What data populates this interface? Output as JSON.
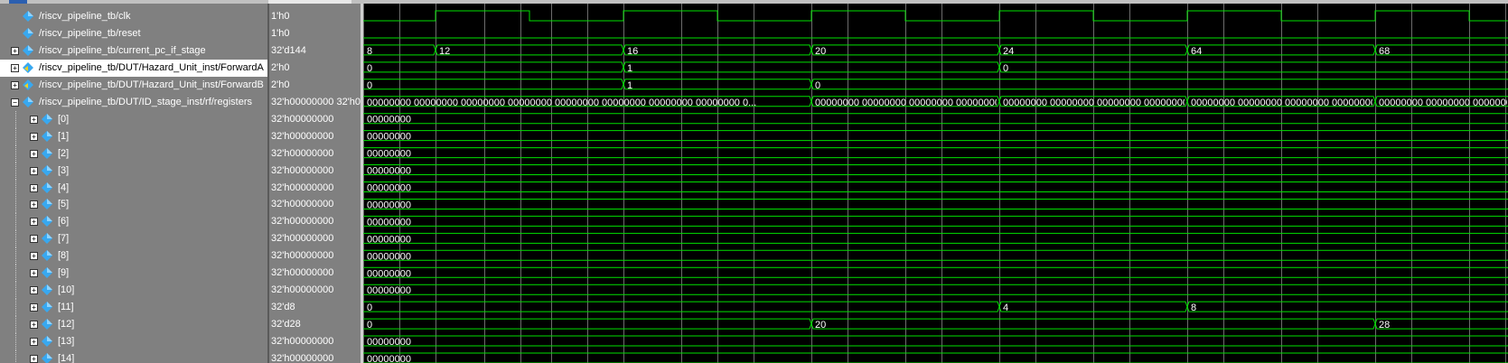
{
  "signals": [
    {
      "name": "/riscv_pipeline_tb/clk",
      "value": "1'h0",
      "expandable": false,
      "expanded": false,
      "icon": "signal-diamond-icon",
      "indent": 0,
      "selected": false
    },
    {
      "name": "/riscv_pipeline_tb/reset",
      "value": "1'h0",
      "expandable": false,
      "expanded": false,
      "icon": "signal-diamond-icon",
      "indent": 0,
      "selected": false
    },
    {
      "name": "/riscv_pipeline_tb/current_pc_if_stage",
      "value": "32'd144",
      "expandable": true,
      "expanded": false,
      "icon": "signal-diamond-icon",
      "indent": 0,
      "selected": false
    },
    {
      "name": "/riscv_pipeline_tb/DUT/Hazard_Unit_inst/ForwardA",
      "value": "2'h0",
      "expandable": true,
      "expanded": false,
      "icon": "output-port-icon",
      "indent": 0,
      "selected": true
    },
    {
      "name": "/riscv_pipeline_tb/DUT/Hazard_Unit_inst/ForwardB",
      "value": "2'h0",
      "expandable": true,
      "expanded": false,
      "icon": "output-port-icon",
      "indent": 0,
      "selected": false
    },
    {
      "name": "/riscv_pipeline_tb/DUT/ID_stage_inst/rf/registers",
      "value": "32'h00000000 32'h0...",
      "expandable": true,
      "expanded": true,
      "icon": "signal-diamond-icon",
      "indent": 0,
      "selected": false
    },
    {
      "name": "[0]",
      "value": "32'h00000000",
      "expandable": true,
      "expanded": false,
      "icon": "signal-diamond-icon",
      "indent": 1,
      "selected": false
    },
    {
      "name": "[1]",
      "value": "32'h00000000",
      "expandable": true,
      "expanded": false,
      "icon": "signal-diamond-icon",
      "indent": 1,
      "selected": false
    },
    {
      "name": "[2]",
      "value": "32'h00000000",
      "expandable": true,
      "expanded": false,
      "icon": "signal-diamond-icon",
      "indent": 1,
      "selected": false
    },
    {
      "name": "[3]",
      "value": "32'h00000000",
      "expandable": true,
      "expanded": false,
      "icon": "signal-diamond-icon",
      "indent": 1,
      "selected": false
    },
    {
      "name": "[4]",
      "value": "32'h00000000",
      "expandable": true,
      "expanded": false,
      "icon": "signal-diamond-icon",
      "indent": 1,
      "selected": false
    },
    {
      "name": "[5]",
      "value": "32'h00000000",
      "expandable": true,
      "expanded": false,
      "icon": "signal-diamond-icon",
      "indent": 1,
      "selected": false
    },
    {
      "name": "[6]",
      "value": "32'h00000000",
      "expandable": true,
      "expanded": false,
      "icon": "signal-diamond-icon",
      "indent": 1,
      "selected": false
    },
    {
      "name": "[7]",
      "value": "32'h00000000",
      "expandable": true,
      "expanded": false,
      "icon": "signal-diamond-icon",
      "indent": 1,
      "selected": false
    },
    {
      "name": "[8]",
      "value": "32'h00000000",
      "expandable": true,
      "expanded": false,
      "icon": "signal-diamond-icon",
      "indent": 1,
      "selected": false
    },
    {
      "name": "[9]",
      "value": "32'h00000000",
      "expandable": true,
      "expanded": false,
      "icon": "signal-diamond-icon",
      "indent": 1,
      "selected": false
    },
    {
      "name": "[10]",
      "value": "32'h00000000",
      "expandable": true,
      "expanded": false,
      "icon": "signal-diamond-icon",
      "indent": 1,
      "selected": false
    },
    {
      "name": "[11]",
      "value": "32'd8",
      "expandable": true,
      "expanded": false,
      "icon": "signal-diamond-icon",
      "indent": 1,
      "selected": false
    },
    {
      "name": "[12]",
      "value": "32'd28",
      "expandable": true,
      "expanded": false,
      "icon": "signal-diamond-icon",
      "indent": 1,
      "selected": false
    },
    {
      "name": "[13]",
      "value": "32'h00000000",
      "expandable": true,
      "expanded": false,
      "icon": "signal-diamond-icon",
      "indent": 1,
      "selected": false
    },
    {
      "name": "[14]",
      "value": "32'h00000000",
      "expandable": true,
      "expanded": false,
      "icon": "signal-diamond-icon",
      "indent": 1,
      "selected": false
    }
  ],
  "waveforms": [
    {
      "kind": "clock",
      "initial": 0,
      "edges": [
        80,
        184,
        288,
        392,
        496,
        600,
        704,
        808,
        912,
        1016,
        1120,
        1224
      ]
    },
    {
      "kind": "bit_const",
      "level": 0
    },
    {
      "kind": "bus",
      "segments": [
        {
          "text": "8"
        },
        {
          "text": "12"
        },
        {
          "text": "16"
        },
        {
          "text": "20"
        },
        {
          "text": "24"
        },
        {
          "text": "64"
        },
        {
          "text": "68"
        }
      ]
    },
    {
      "kind": "bus",
      "segments": [
        {
          "text": "0"
        },
        {
          "text": "1"
        },
        {
          "text": "0"
        }
      ]
    },
    {
      "kind": "bus",
      "segments": [
        {
          "text": "0"
        },
        {
          "text": "1"
        },
        {
          "text": "0"
        }
      ]
    },
    {
      "kind": "bus",
      "segments": [
        {
          "text": "00000000 00000000 00000000 00000000 00000000 00000000 00000000 00000000 0..."
        },
        {
          "text": "00000000 00000000 00000000 00000000 000..."
        },
        {
          "text": "00000000 00000000 00000000 00000000 000..."
        },
        {
          "text": "00000000 00000000 00000000 00000000 000..."
        },
        {
          "text": "00000000 00000000 00000000 00000000 000..."
        }
      ]
    },
    {
      "kind": "bus",
      "segments": [
        {
          "text": "00000000"
        }
      ]
    },
    {
      "kind": "bus",
      "segments": [
        {
          "text": "00000000"
        }
      ]
    },
    {
      "kind": "bus",
      "segments": [
        {
          "text": "00000000"
        }
      ]
    },
    {
      "kind": "bus",
      "segments": [
        {
          "text": "00000000"
        }
      ]
    },
    {
      "kind": "bus",
      "segments": [
        {
          "text": "00000000"
        }
      ]
    },
    {
      "kind": "bus",
      "segments": [
        {
          "text": "00000000"
        }
      ]
    },
    {
      "kind": "bus",
      "segments": [
        {
          "text": "00000000"
        }
      ]
    },
    {
      "kind": "bus",
      "segments": [
        {
          "text": "00000000"
        }
      ]
    },
    {
      "kind": "bus",
      "segments": [
        {
          "text": "00000000"
        }
      ]
    },
    {
      "kind": "bus",
      "segments": [
        {
          "text": "00000000"
        }
      ]
    },
    {
      "kind": "bus",
      "segments": [
        {
          "text": "00000000"
        }
      ]
    },
    {
      "kind": "bus",
      "segments": [
        {
          "text": "0"
        },
        {
          "text": "4"
        },
        {
          "text": "8"
        }
      ]
    },
    {
      "kind": "bus",
      "segments": [
        {
          "text": "0"
        },
        {
          "text": "20"
        },
        {
          "text": "28"
        }
      ]
    },
    {
      "kind": "bus",
      "segments": [
        {
          "text": "00000000"
        }
      ]
    },
    {
      "kind": "bus",
      "segments": [
        {
          "text": "00000000"
        }
      ]
    }
  ],
  "colors": {
    "wave": "#00e000",
    "grid": "#6c6c6c",
    "text": "#ffffff",
    "panel": "#808080",
    "selected_row": "#ffffff",
    "signal_icon": "#38a8f0"
  }
}
